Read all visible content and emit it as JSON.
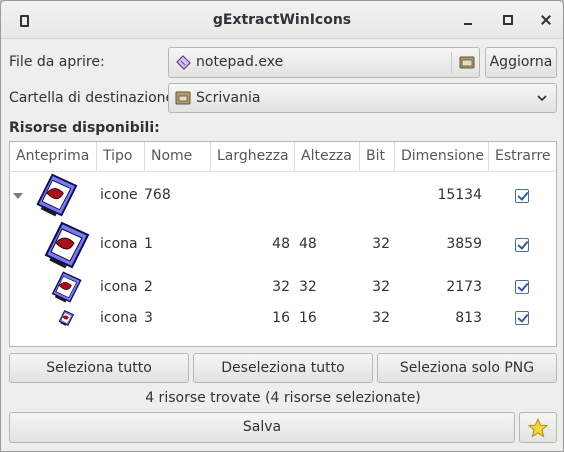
{
  "window": {
    "title": "gExtractWinIcons"
  },
  "file": {
    "label": "File da aprire:",
    "value": "notepad.exe",
    "refresh_label": "Aggiorna"
  },
  "destination": {
    "label": "Cartella di destinazione:",
    "value": "Scrivania"
  },
  "resources": {
    "label": "Risorse disponibili:",
    "columns": [
      "Anteprima",
      "Tipo",
      "Nome",
      "Larghezza",
      "Altezza",
      "Bit",
      "Dimensione",
      "Estrarre"
    ],
    "rows": [
      {
        "tipo": "icone",
        "nome": "768",
        "larghezza": "",
        "altezza": "",
        "bit": "",
        "dimensione": "15134",
        "estrarre": true
      },
      {
        "tipo": "icona",
        "nome": "1",
        "larghezza": "48",
        "altezza": "48",
        "bit": "32",
        "dimensione": "3859",
        "estrarre": true
      },
      {
        "tipo": "icona",
        "nome": "2",
        "larghezza": "32",
        "altezza": "32",
        "bit": "32",
        "dimensione": "2173",
        "estrarre": true
      },
      {
        "tipo": "icona",
        "nome": "3",
        "larghezza": "16",
        "altezza": "16",
        "bit": "32",
        "dimensione": "813",
        "estrarre": true
      }
    ]
  },
  "actions": {
    "select_all": "Seleziona tutto",
    "deselect_all": "Deseleziona tutto",
    "select_png": "Seleziona solo PNG"
  },
  "status": "4 risorse trovate (4 risorse selezionate)",
  "save_label": "Salva",
  "icons": {
    "file": "notepad-file-icon",
    "folder": "folder-icon",
    "desktop": "desktop-folder-icon",
    "preview": "notepad-icon",
    "about": "star-icon"
  }
}
